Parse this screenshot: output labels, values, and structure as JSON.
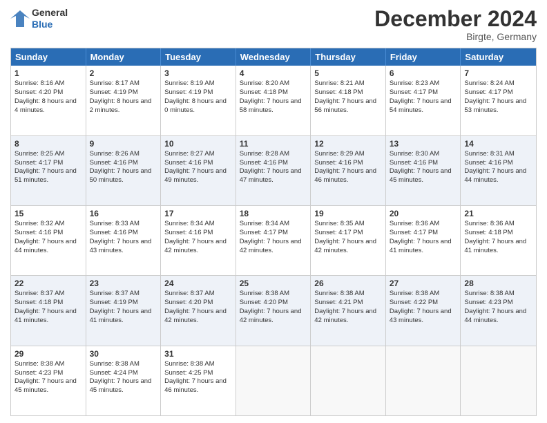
{
  "logo": {
    "line1": "General",
    "line2": "Blue"
  },
  "title": "December 2024",
  "location": "Birgte, Germany",
  "weekdays": [
    "Sunday",
    "Monday",
    "Tuesday",
    "Wednesday",
    "Thursday",
    "Friday",
    "Saturday"
  ],
  "rows": [
    [
      {
        "day": "1",
        "sunrise": "8:16 AM",
        "sunset": "4:20 PM",
        "daylight": "8 hours and 4 minutes."
      },
      {
        "day": "2",
        "sunrise": "8:17 AM",
        "sunset": "4:19 PM",
        "daylight": "8 hours and 2 minutes."
      },
      {
        "day": "3",
        "sunrise": "8:19 AM",
        "sunset": "4:19 PM",
        "daylight": "8 hours and 0 minutes."
      },
      {
        "day": "4",
        "sunrise": "8:20 AM",
        "sunset": "4:18 PM",
        "daylight": "7 hours and 58 minutes."
      },
      {
        "day": "5",
        "sunrise": "8:21 AM",
        "sunset": "4:18 PM",
        "daylight": "7 hours and 56 minutes."
      },
      {
        "day": "6",
        "sunrise": "8:23 AM",
        "sunset": "4:17 PM",
        "daylight": "7 hours and 54 minutes."
      },
      {
        "day": "7",
        "sunrise": "8:24 AM",
        "sunset": "4:17 PM",
        "daylight": "7 hours and 53 minutes."
      }
    ],
    [
      {
        "day": "8",
        "sunrise": "8:25 AM",
        "sunset": "4:17 PM",
        "daylight": "7 hours and 51 minutes."
      },
      {
        "day": "9",
        "sunrise": "8:26 AM",
        "sunset": "4:16 PM",
        "daylight": "7 hours and 50 minutes."
      },
      {
        "day": "10",
        "sunrise": "8:27 AM",
        "sunset": "4:16 PM",
        "daylight": "7 hours and 49 minutes."
      },
      {
        "day": "11",
        "sunrise": "8:28 AM",
        "sunset": "4:16 PM",
        "daylight": "7 hours and 47 minutes."
      },
      {
        "day": "12",
        "sunrise": "8:29 AM",
        "sunset": "4:16 PM",
        "daylight": "7 hours and 46 minutes."
      },
      {
        "day": "13",
        "sunrise": "8:30 AM",
        "sunset": "4:16 PM",
        "daylight": "7 hours and 45 minutes."
      },
      {
        "day": "14",
        "sunrise": "8:31 AM",
        "sunset": "4:16 PM",
        "daylight": "7 hours and 44 minutes."
      }
    ],
    [
      {
        "day": "15",
        "sunrise": "8:32 AM",
        "sunset": "4:16 PM",
        "daylight": "7 hours and 44 minutes."
      },
      {
        "day": "16",
        "sunrise": "8:33 AM",
        "sunset": "4:16 PM",
        "daylight": "7 hours and 43 minutes."
      },
      {
        "day": "17",
        "sunrise": "8:34 AM",
        "sunset": "4:16 PM",
        "daylight": "7 hours and 42 minutes."
      },
      {
        "day": "18",
        "sunrise": "8:34 AM",
        "sunset": "4:17 PM",
        "daylight": "7 hours and 42 minutes."
      },
      {
        "day": "19",
        "sunrise": "8:35 AM",
        "sunset": "4:17 PM",
        "daylight": "7 hours and 42 minutes."
      },
      {
        "day": "20",
        "sunrise": "8:36 AM",
        "sunset": "4:17 PM",
        "daylight": "7 hours and 41 minutes."
      },
      {
        "day": "21",
        "sunrise": "8:36 AM",
        "sunset": "4:18 PM",
        "daylight": "7 hours and 41 minutes."
      }
    ],
    [
      {
        "day": "22",
        "sunrise": "8:37 AM",
        "sunset": "4:18 PM",
        "daylight": "7 hours and 41 minutes."
      },
      {
        "day": "23",
        "sunrise": "8:37 AM",
        "sunset": "4:19 PM",
        "daylight": "7 hours and 41 minutes."
      },
      {
        "day": "24",
        "sunrise": "8:37 AM",
        "sunset": "4:20 PM",
        "daylight": "7 hours and 42 minutes."
      },
      {
        "day": "25",
        "sunrise": "8:38 AM",
        "sunset": "4:20 PM",
        "daylight": "7 hours and 42 minutes."
      },
      {
        "day": "26",
        "sunrise": "8:38 AM",
        "sunset": "4:21 PM",
        "daylight": "7 hours and 42 minutes."
      },
      {
        "day": "27",
        "sunrise": "8:38 AM",
        "sunset": "4:22 PM",
        "daylight": "7 hours and 43 minutes."
      },
      {
        "day": "28",
        "sunrise": "8:38 AM",
        "sunset": "4:23 PM",
        "daylight": "7 hours and 44 minutes."
      }
    ],
    [
      {
        "day": "29",
        "sunrise": "8:38 AM",
        "sunset": "4:23 PM",
        "daylight": "7 hours and 45 minutes."
      },
      {
        "day": "30",
        "sunrise": "8:38 AM",
        "sunset": "4:24 PM",
        "daylight": "7 hours and 45 minutes."
      },
      {
        "day": "31",
        "sunrise": "8:38 AM",
        "sunset": "4:25 PM",
        "daylight": "7 hours and 46 minutes."
      },
      null,
      null,
      null,
      null
    ]
  ],
  "labels": {
    "sunrise": "Sunrise:",
    "sunset": "Sunset:",
    "daylight": "Daylight:"
  }
}
